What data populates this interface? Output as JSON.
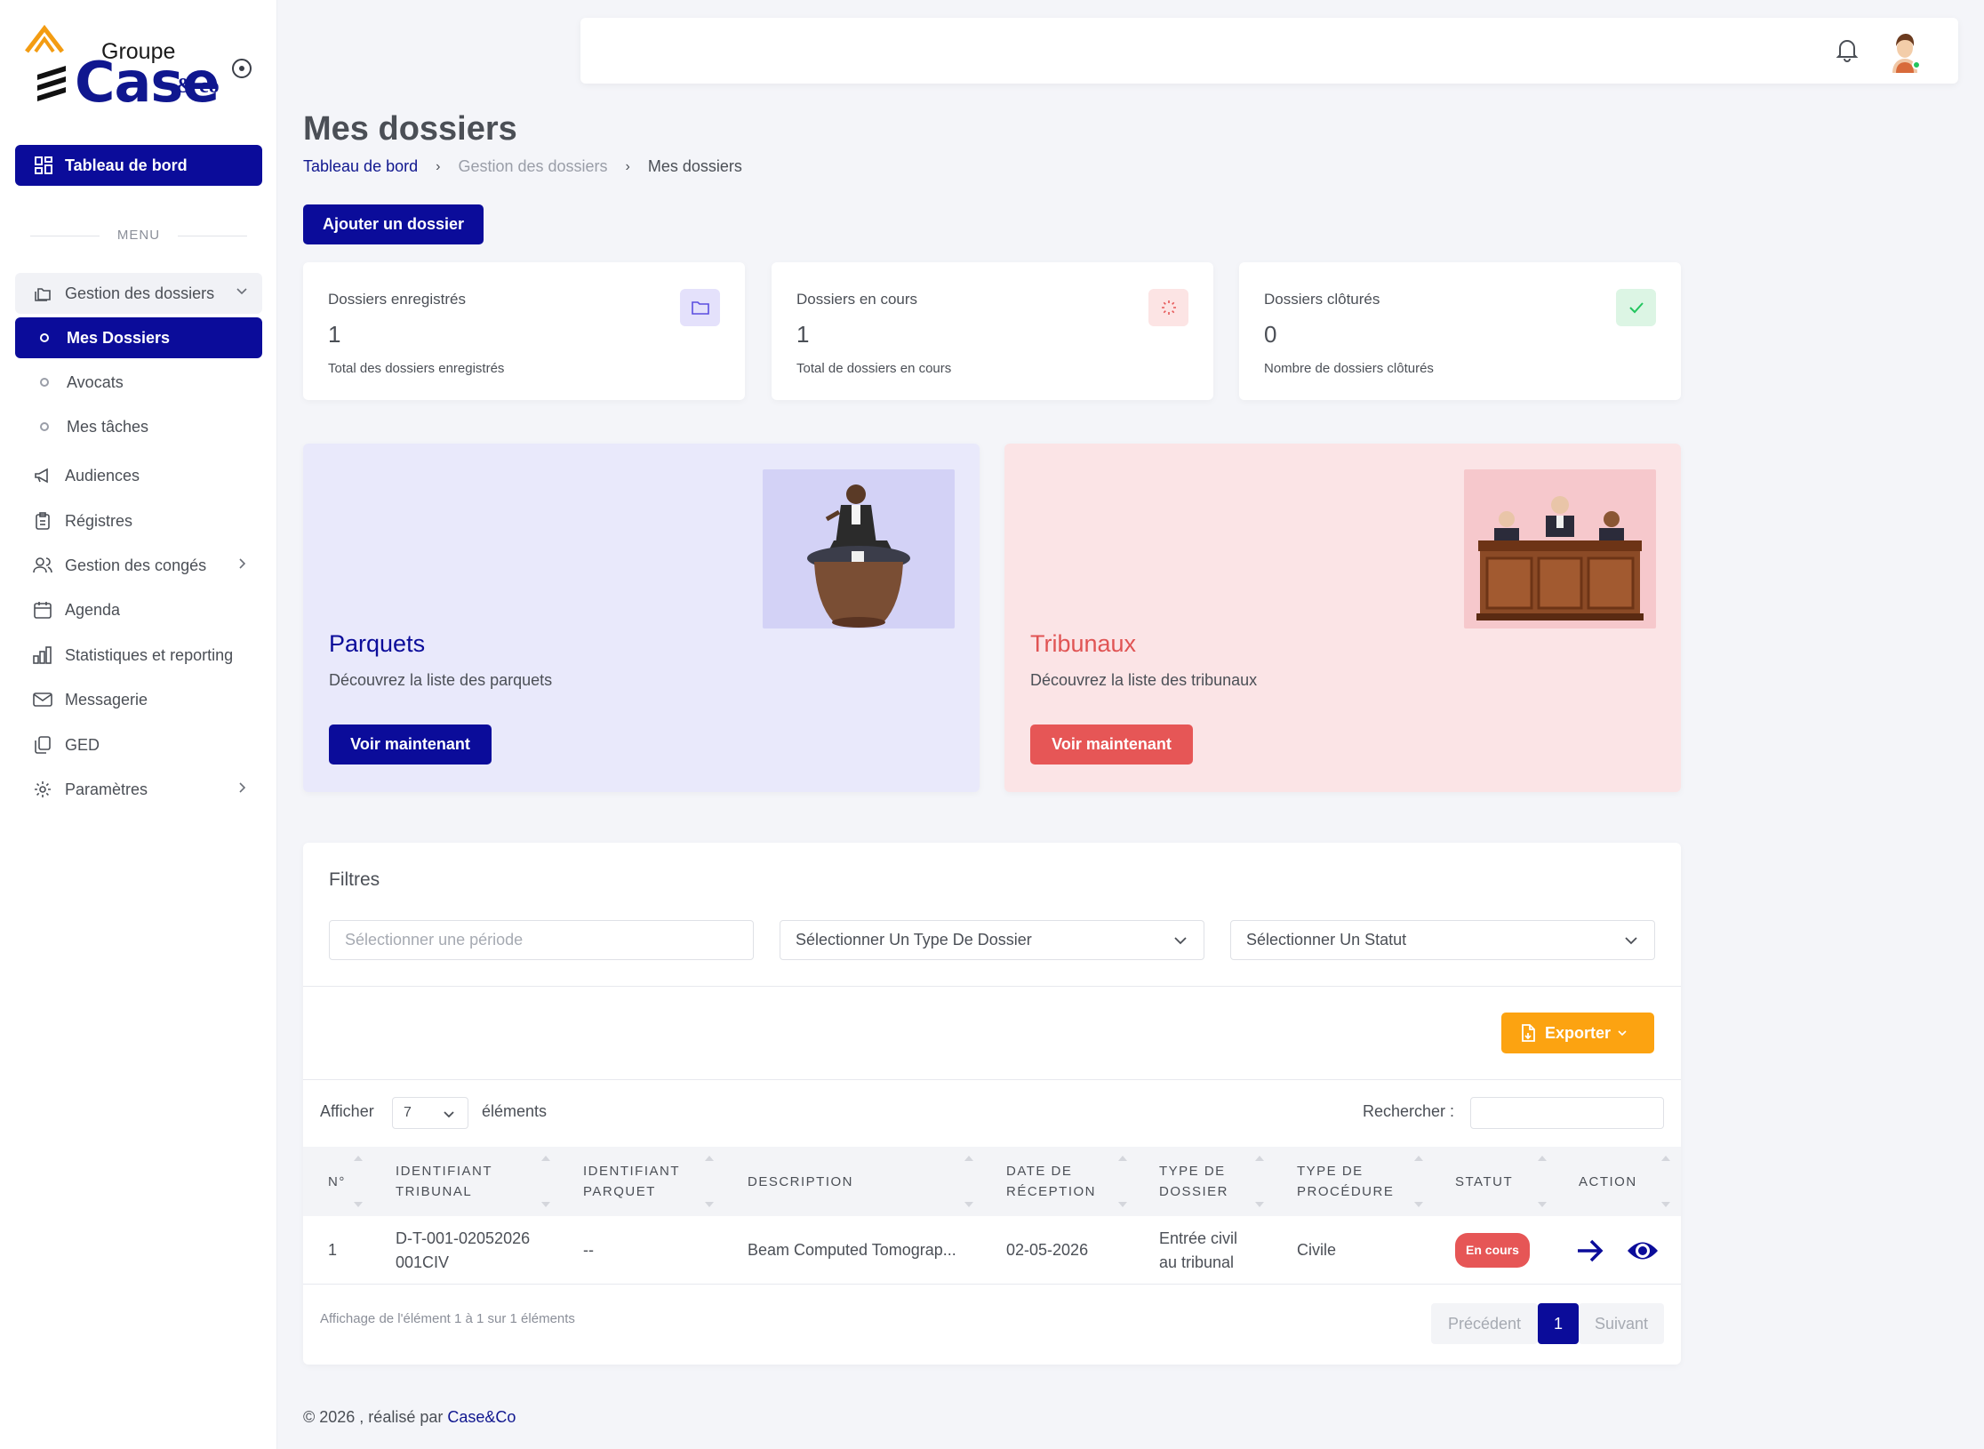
{
  "logo": {
    "groupe": "Groupe",
    "case": "Case",
    "andco": "& co"
  },
  "sidebar": {
    "dashboard_label": "Tableau de bord",
    "menu_label": "MENU",
    "items": [
      {
        "label": "Gestion des dossiers",
        "icon": "folders-icon"
      },
      {
        "label": "Mes Dossiers"
      },
      {
        "label": "Avocats"
      },
      {
        "label": "Mes tâches"
      },
      {
        "label": "Audiences",
        "icon": "megaphone-icon"
      },
      {
        "label": "Régistres",
        "icon": "clipboard-icon"
      },
      {
        "label": "Gestion des congés",
        "icon": "users-icon"
      },
      {
        "label": "Agenda",
        "icon": "calendar-icon"
      },
      {
        "label": "Statistiques et reporting",
        "icon": "bar-chart-icon"
      },
      {
        "label": "Messagerie",
        "icon": "mail-icon"
      },
      {
        "label": "GED",
        "icon": "files-icon"
      },
      {
        "label": "Paramètres",
        "icon": "gear-icon"
      }
    ]
  },
  "header": {
    "title": "Mes dossiers",
    "breadcrumb": [
      "Tableau de bord",
      "Gestion des dossiers",
      "Mes dossiers"
    ],
    "add_button": "Ajouter un dossier"
  },
  "stats": [
    {
      "label": "Dossiers enregistrés",
      "value": "1",
      "sub": "Total des dossiers enregistrés",
      "icon": "folder-icon",
      "color": "#5b4ee0"
    },
    {
      "label": "Dossiers en cours",
      "value": "1",
      "sub": "Total de dossiers en cours",
      "icon": "loader-icon",
      "color": "#e65656"
    },
    {
      "label": "Dossiers clôturés",
      "value": "0",
      "sub": "Nombre de dossiers clôturés",
      "icon": "check-icon",
      "color": "#22c55e"
    }
  ],
  "promos": [
    {
      "title": "Parquets",
      "desc": "Découvrez la liste des parquets",
      "button": "Voir maintenant"
    },
    {
      "title": "Tribunaux",
      "desc": "Découvrez la liste des tribunaux",
      "button": "Voir maintenant"
    }
  ],
  "filters": {
    "title": "Filtres",
    "period_placeholder": "Sélectionner une période",
    "type_value": "Sélectionner Un Type De Dossier",
    "status_value": "Sélectionner Un Statut"
  },
  "toolbar": {
    "export_label": "Exporter"
  },
  "table": {
    "show_label": "Afficher",
    "page_length": "7",
    "elements_label": "éléments",
    "search_label": "Rechercher :",
    "columns": [
      "N°",
      "Identifiant Tribunal",
      "Identifiant Parquet",
      "Description",
      "Date de réception",
      "Type de dossier",
      "Type de procédure",
      "Statut",
      "Action"
    ],
    "rows": [
      {
        "n": "1",
        "id_tribunal": "D-T-001-02052026001CIV",
        "id_parquet": "--",
        "description": "Beam Computed Tomograp...",
        "date": "02-05-2026",
        "type_dossier": "Entrée civil au tribunal",
        "type_procedure": "Civile",
        "statut": "En cours"
      }
    ],
    "info": "Affichage de l'élément 1 à 1 sur 1 éléments",
    "prev": "Précédent",
    "page": "1",
    "next": "Suivant"
  },
  "footer": {
    "text": "© 2026 , réalisé par",
    "brand": "Case&Co"
  },
  "colors": {
    "primary": "#0b0c9a",
    "danger": "#e65656",
    "warning": "#fca311"
  }
}
